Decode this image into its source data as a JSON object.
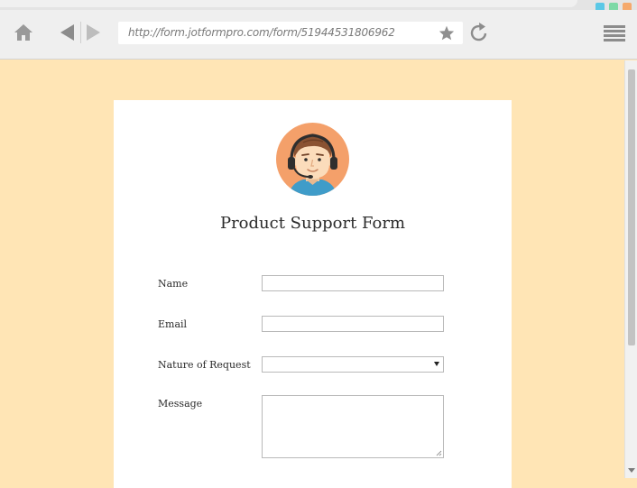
{
  "browser": {
    "url": "http://form.jotformpro.com/form/51944531806962",
    "window_controls": [
      {
        "name": "minimize",
        "color": "#5bc8e6"
      },
      {
        "name": "maximize",
        "color": "#7dd9a6"
      },
      {
        "name": "close",
        "color": "#f5a96c"
      }
    ],
    "icons": {
      "home": "home-icon",
      "back": "back-arrow-icon",
      "forward": "forward-arrow-icon",
      "bookmark": "star-icon",
      "reload": "reload-icon",
      "menu": "hamburger-menu-icon"
    }
  },
  "page": {
    "background_color": "#ffe5b5"
  },
  "form": {
    "avatar_icon": "support-agent-avatar-icon",
    "title": "Product Support Form",
    "fields": {
      "name": {
        "label": "Name",
        "value": ""
      },
      "email": {
        "label": "Email",
        "value": ""
      },
      "nature": {
        "label": "Nature of Request",
        "selected": ""
      },
      "message": {
        "label": "Message",
        "value": ""
      }
    }
  }
}
